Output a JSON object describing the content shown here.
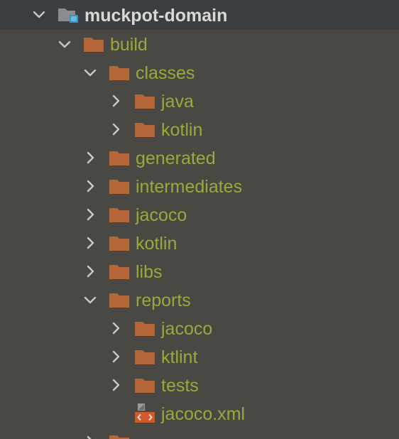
{
  "colors": {
    "background": "#4a4843",
    "header_background": "#3c3f41",
    "folder": "#b5653a",
    "excluded_text": "#a0a63d",
    "root_text": "#d8d8d8",
    "chevron": "#c8c8c8"
  },
  "tree": {
    "root": {
      "label": "muckpot-domain",
      "icon": "module-folder-icon",
      "expanded": true
    },
    "items": [
      {
        "label": "build",
        "icon": "folder-icon",
        "expanded": true,
        "depth": 1
      },
      {
        "label": "classes",
        "icon": "folder-icon",
        "expanded": true,
        "depth": 2
      },
      {
        "label": "java",
        "icon": "folder-icon",
        "expanded": false,
        "depth": 3
      },
      {
        "label": "kotlin",
        "icon": "folder-icon",
        "expanded": false,
        "depth": 3
      },
      {
        "label": "generated",
        "icon": "folder-icon",
        "expanded": false,
        "depth": 2
      },
      {
        "label": "intermediates",
        "icon": "folder-icon",
        "expanded": false,
        "depth": 2
      },
      {
        "label": "jacoco",
        "icon": "folder-icon",
        "expanded": false,
        "depth": 2
      },
      {
        "label": "kotlin",
        "icon": "folder-icon",
        "expanded": false,
        "depth": 2
      },
      {
        "label": "libs",
        "icon": "folder-icon",
        "expanded": false,
        "depth": 2
      },
      {
        "label": "reports",
        "icon": "folder-icon",
        "expanded": true,
        "depth": 2
      },
      {
        "label": "jacoco",
        "icon": "folder-icon",
        "expanded": false,
        "depth": 3
      },
      {
        "label": "ktlint",
        "icon": "folder-icon",
        "expanded": false,
        "depth": 3
      },
      {
        "label": "tests",
        "icon": "folder-icon",
        "expanded": false,
        "depth": 3
      },
      {
        "label": "jacoco.xml",
        "icon": "xml-file-icon",
        "expanded": null,
        "depth": 3
      }
    ]
  }
}
